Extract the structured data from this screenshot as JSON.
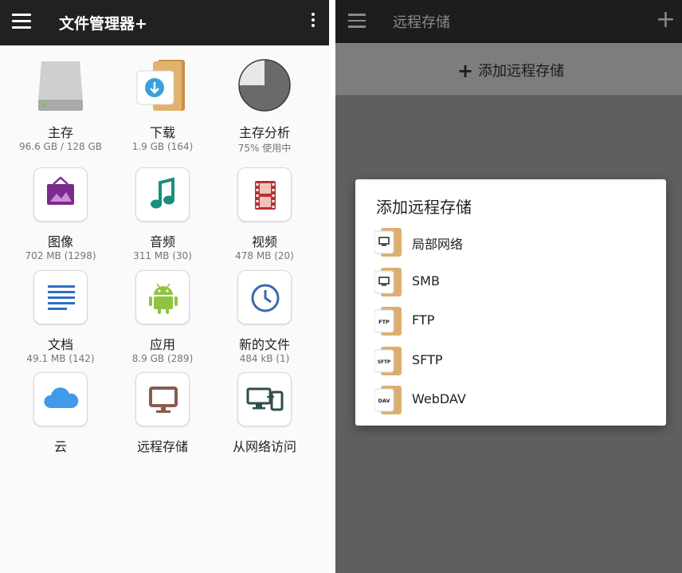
{
  "left": {
    "toolbar": {
      "title": "文件管理器+",
      "menu_icon": "hamburger-icon",
      "more_icon": "more-vert-icon"
    },
    "items": [
      {
        "label": "主存",
        "sub": "96.6 GB / 128 GB",
        "icon": "drive-icon"
      },
      {
        "label": "下载",
        "sub": "1.9 GB (164)",
        "icon": "download-folder-icon"
      },
      {
        "label": "主存分析",
        "sub": "75% 使用中",
        "icon": "pie-chart-icon",
        "usage_fraction": 0.75
      },
      {
        "label": "图像",
        "sub": "702 MB (1298)",
        "icon": "image-icon"
      },
      {
        "label": "音频",
        "sub": "311 MB (30)",
        "icon": "music-note-icon"
      },
      {
        "label": "视频",
        "sub": "478 MB (20)",
        "icon": "film-icon"
      },
      {
        "label": "文档",
        "sub": "49.1 MB (142)",
        "icon": "document-lines-icon"
      },
      {
        "label": "应用",
        "sub": "8.9 GB (289)",
        "icon": "android-icon"
      },
      {
        "label": "新的文件",
        "sub": "484 kB (1)",
        "icon": "clock-icon"
      },
      {
        "label": "云",
        "sub": "",
        "icon": "cloud-icon"
      },
      {
        "label": "远程存储",
        "sub": "",
        "icon": "monitor-icon"
      },
      {
        "label": "从网络访问",
        "sub": "",
        "icon": "devices-icon"
      }
    ]
  },
  "right": {
    "toolbar": {
      "title": "远程存储",
      "plus_label": "+"
    },
    "add_button": {
      "label": "添加远程存储",
      "plus": "+"
    },
    "dialog": {
      "title": "添加远程存储",
      "options": [
        {
          "label": "局部网络",
          "badge": "",
          "icon": "lan-folder-icon"
        },
        {
          "label": "SMB",
          "badge": "",
          "icon": "smb-folder-icon"
        },
        {
          "label": "FTP",
          "badge": "FTP",
          "icon": "ftp-folder-icon"
        },
        {
          "label": "SFTP",
          "badge": "SFTP",
          "icon": "sftp-folder-icon"
        },
        {
          "label": "WebDAV",
          "badge": "DAV",
          "icon": "webdav-folder-icon"
        }
      ]
    }
  },
  "colors": {
    "toolbar_bg": "#212121",
    "folder_tan": "#dcae6e",
    "image_purple": "#7b2a8e",
    "music_teal": "#17907d",
    "film_red": "#b8322e",
    "doc_blue": "#2f6fc1",
    "android_green": "#8ec442",
    "clock_blue": "#3b6aa8",
    "cloud_blue": "#3f9ae8",
    "monitor_brown": "#8a5a4d"
  }
}
